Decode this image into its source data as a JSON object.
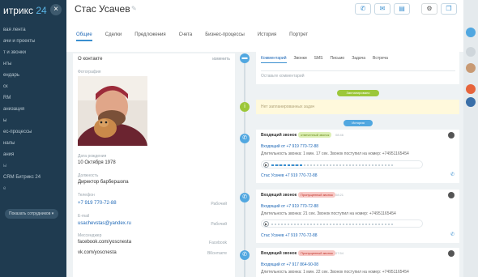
{
  "sidebar": {
    "logo": "итрикс",
    "logo_num": "24",
    "items": [
      "вая лента",
      "ачи и проекты",
      "т и звонки",
      "нты",
      "ендарь",
      "ск",
      "RM",
      "анизация",
      "ы",
      "ес-процессы",
      "налы",
      "ания",
      "ы",
      "CRM Битрикс 24",
      "е"
    ],
    "pill": "Показать сотрудников"
  },
  "header": {
    "title": "Стас Усачев",
    "tabs": [
      "Общие",
      "Сделки",
      "Предложения",
      "Счета",
      "Бизнес-процессы",
      "История",
      "Портрет"
    ]
  },
  "info": {
    "head": "О контакте",
    "edit": "изменить",
    "photo_label": "Фотография",
    "birthday_label": "Дата рождения",
    "birthday": "10 Октября 1978",
    "position_label": "Должность",
    "position": "Директор барбершопа",
    "phone_label": "Телефон",
    "phone": "+7 919 770-72-88",
    "phone_tag": "Рабочий",
    "email_label": "E-mail",
    "email": "usachevstas@yandex.ru",
    "email_tag": "Рабочий",
    "messenger_label": "Мессенджер",
    "messenger1": "facebook.com/yoscnesta",
    "messenger1_tag": "Facebook",
    "messenger2": "vk.com/yoscnesta",
    "messenger2_tag": "ВКонтакте"
  },
  "composer": {
    "tabs": [
      "Комментарий",
      "Звонки",
      "SMS",
      "Письмо",
      "Задача",
      "Встреча"
    ],
    "placeholder": "Оставьте комментарий"
  },
  "timeline": {
    "scheduled_pill": "Запланировано",
    "history_pill": "История",
    "notice": "Нет запланированных задач",
    "calls": [
      {
        "title": "Входящий звонок",
        "badge": "отвеченный звонок",
        "time": "08:46",
        "from": "Входящий от +7 919 770-72-88",
        "duration": "Длительность звонка: 1 мин. 17 сек. Звонок поступил на номер: +74951165454",
        "person": "Стас Усачев +7 919 770-72-88"
      },
      {
        "title": "Входящий звонок",
        "badge": "Пропущенный звонок",
        "time": "08:21",
        "from": "Входящий от +7 919 770-72-88",
        "duration": "Длительность звонка: 21 сек. Звонок поступил на номер: +74951165454",
        "person": "Стас Усачев +7 919 770-72-88"
      },
      {
        "title": "Входящий звонок",
        "badge": "Пропущенный звонок",
        "time": "07:54",
        "from": "Входящий от +7 917 864-90-08",
        "duration": "Длительность звонка: 1 мин. 22 сек. Звонок поступил на номер: +74951165454"
      }
    ]
  },
  "colors": {
    "accent": "#3a8fd0",
    "sidebar": "#1f3b50",
    "green": "#9cc739",
    "missed": "#c2362c"
  }
}
